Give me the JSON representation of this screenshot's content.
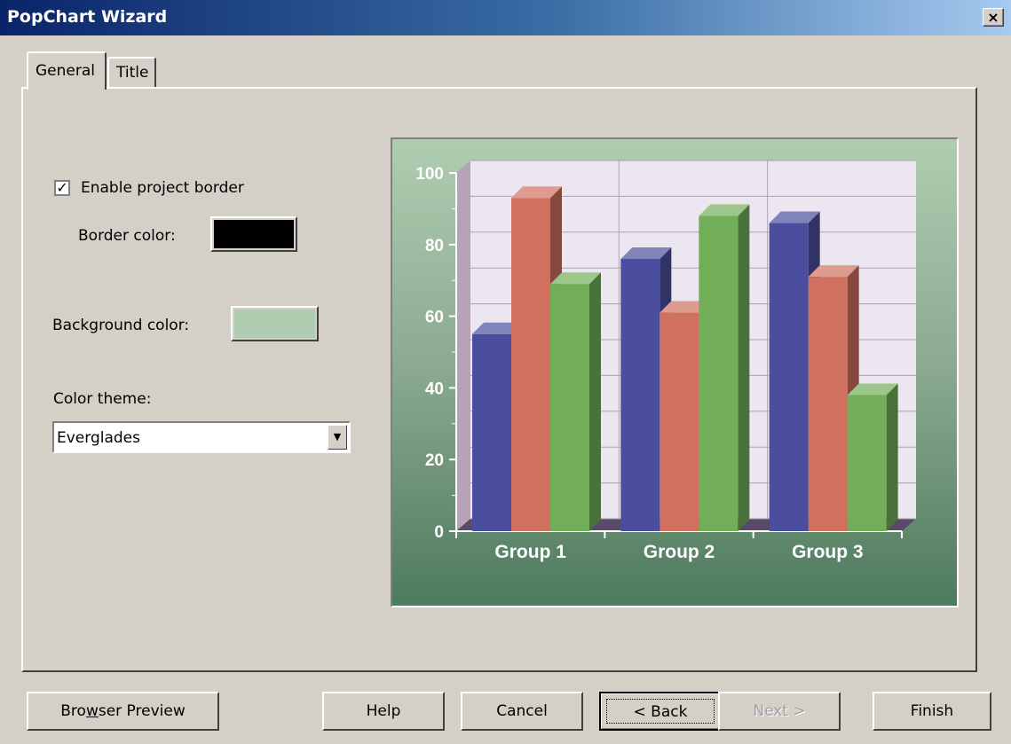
{
  "window": {
    "title": "PopChart Wizard",
    "close_label": "×"
  },
  "tabs": [
    {
      "label": "General",
      "active": true
    },
    {
      "label": "Title",
      "active": false
    }
  ],
  "general": {
    "enable_border_label": "Enable project border",
    "enable_border_checked": true,
    "border_color_label": "Border color:",
    "border_color": "#000000",
    "background_color_label": "Background color:",
    "background_color": "#afcdb1",
    "color_theme_label": "Color theme:",
    "color_theme_value": "Everglades"
  },
  "chart_data": {
    "type": "bar",
    "categories": [
      "Group 1",
      "Group 2",
      "Group 3"
    ],
    "series": [
      {
        "values": [
          55,
          76,
          86
        ],
        "color": "#4b4e9e"
      },
      {
        "values": [
          93,
          61,
          71
        ],
        "color": "#d0705f"
      },
      {
        "values": [
          69,
          88,
          38
        ],
        "color": "#72ae58"
      }
    ],
    "ylim": [
      0,
      100
    ],
    "yticks": [
      "0",
      "20",
      "40",
      "60",
      "80",
      "100"
    ],
    "grid": true,
    "plot_background": "#ebe6ef",
    "background_gradient": [
      "#afcdb1",
      "#4e7a5d"
    ]
  },
  "buttons": {
    "browser_preview_prefix": "Bro",
    "browser_preview_accel": "w",
    "browser_preview_suffix": "ser Preview",
    "help": "Help",
    "cancel": "Cancel",
    "back": "< Back",
    "next": "Next >",
    "finish": "Finish"
  }
}
